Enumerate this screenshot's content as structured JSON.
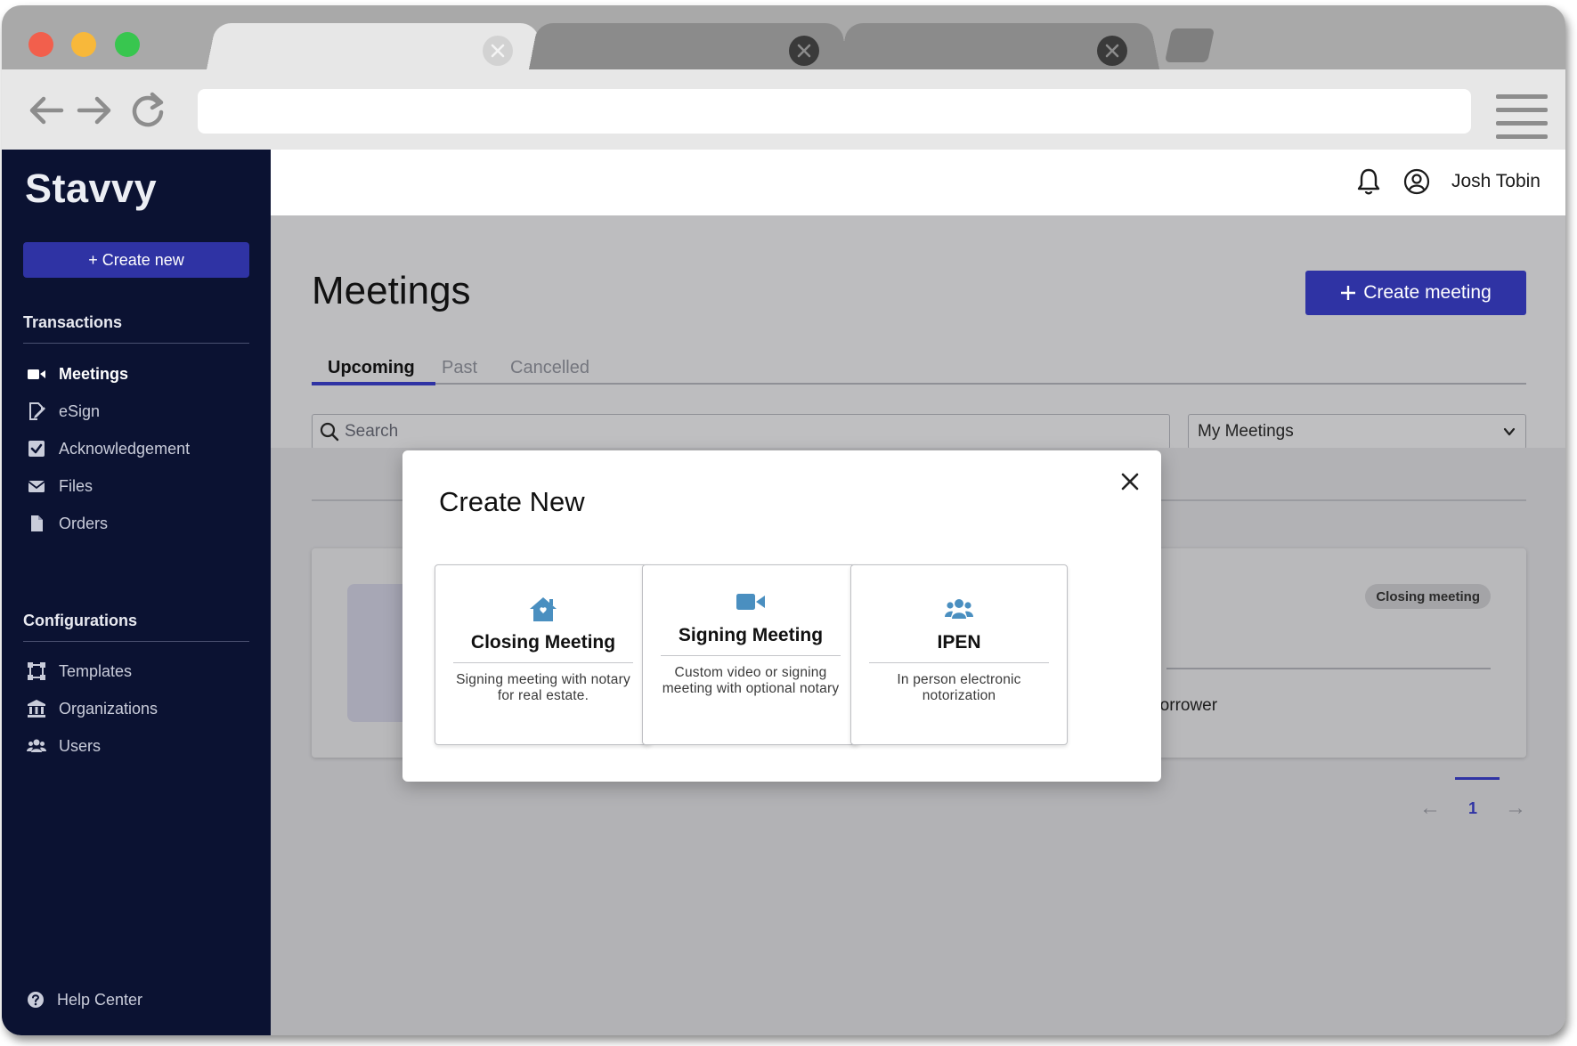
{
  "browser": {
    "tabs": [
      {
        "state": "active",
        "close_icon": "close-icon"
      },
      {
        "state": "inactive",
        "close_icon": "close-icon"
      },
      {
        "state": "inactive",
        "close_icon": "close-icon"
      }
    ],
    "address_value": ""
  },
  "sidebar": {
    "logo": "Stavvy",
    "create_new_label": "+ Create new",
    "sections": {
      "transactions": "Transactions",
      "configurations": "Configurations"
    },
    "transaction_items": [
      {
        "label": "Meetings",
        "icon": "video-camera-icon",
        "active": true
      },
      {
        "label": "eSign",
        "icon": "signature-icon"
      },
      {
        "label": "Acknowledgement",
        "icon": "checkbox-icon"
      },
      {
        "label": "Files",
        "icon": "envelope-icon"
      },
      {
        "label": "Orders",
        "icon": "document-icon"
      }
    ],
    "configuration_items": [
      {
        "label": "Templates",
        "icon": "template-icon"
      },
      {
        "label": "Organizations",
        "icon": "institution-icon"
      },
      {
        "label": "Users",
        "icon": "users-icon"
      }
    ],
    "help_label": "Help Center"
  },
  "header": {
    "user_name": "Josh Tobin"
  },
  "main": {
    "title": "Meetings",
    "create_meeting_label": "Create meeting",
    "tabs": [
      {
        "label": "Upcoming",
        "active": true
      },
      {
        "label": "Past"
      },
      {
        "label": "Cancelled"
      }
    ],
    "search_placeholder": "Search",
    "filter_value": "My Meetings",
    "card": {
      "badge": "Closing meeting",
      "role": "Borrower"
    },
    "pagination": {
      "current_page": "1",
      "prev": "←",
      "next": "→"
    }
  },
  "modal": {
    "title": "Create New",
    "options": [
      {
        "title": "Closing Meeting",
        "description": "Signing meeting with notary for real estate.",
        "icon": "house-icon"
      },
      {
        "title": "Signing Meeting",
        "description": "Custom video or signing meeting with optional notary",
        "icon": "video-camera-icon"
      },
      {
        "title": "IPEN",
        "description": "In person electronic notorization",
        "icon": "users-icon"
      }
    ]
  },
  "colors": {
    "sidebar_bg": "#0b1232",
    "primary": "#2f33a4",
    "icon_accent": "#4a8fc0"
  }
}
